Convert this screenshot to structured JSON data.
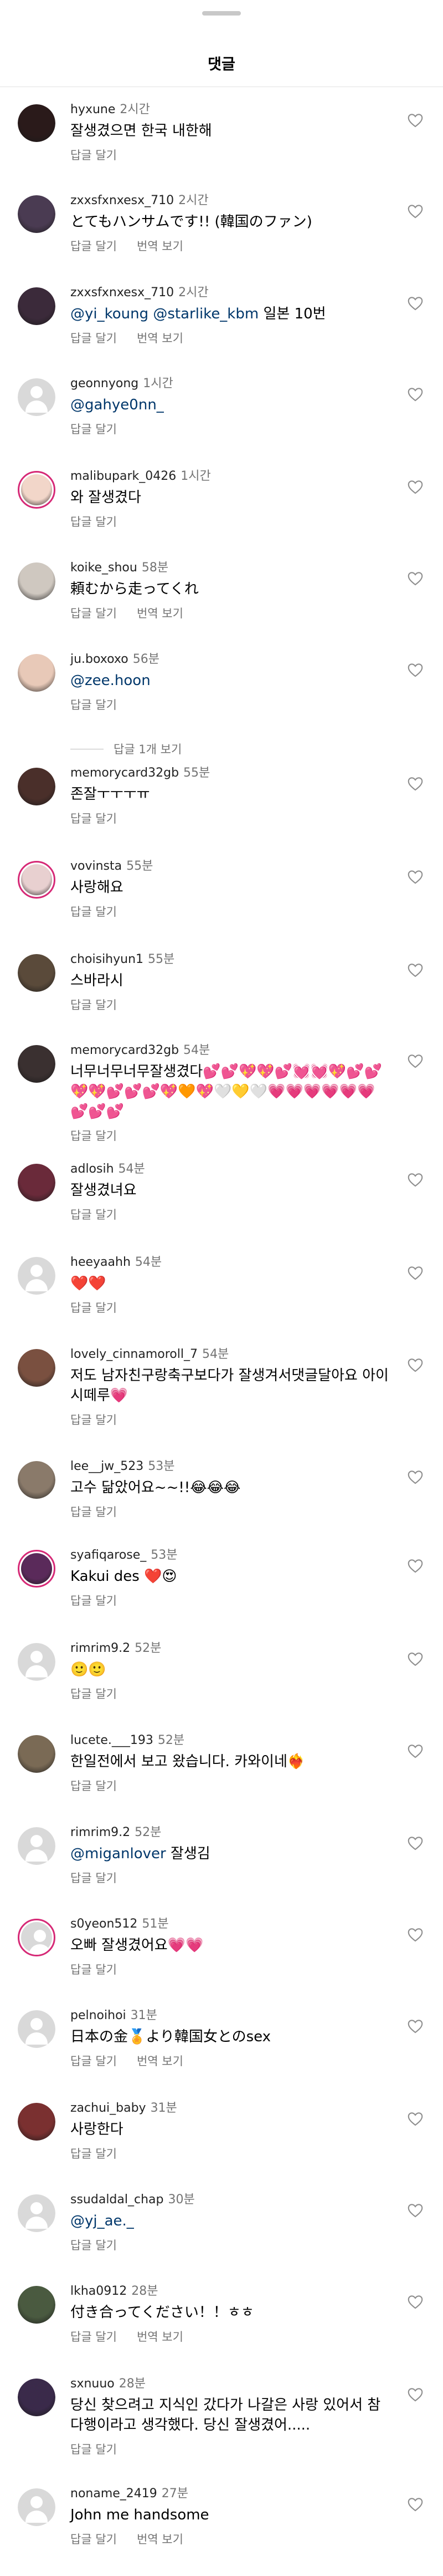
{
  "sheet": {
    "title": "댓글"
  },
  "actions": {
    "reply": "답글 달기",
    "translate": "번역 보기"
  },
  "comments": [
    {
      "user": "hyxune",
      "time": "2시간",
      "text": "잘생겼으면 한국 내한해",
      "translate": false
    },
    {
      "user": "zxxsfxnxesx_710",
      "time": "2시간",
      "text": "とてもハンサムです!! (韓国のファン)",
      "translate": true
    },
    {
      "user": "zxxsfxnxesx_710",
      "time": "2시간",
      "mentions": [
        "@yi_koung",
        "@starlike_kbm"
      ],
      "text": "일본 10번",
      "translate": true
    },
    {
      "user": "geonnyong",
      "time": "1시간",
      "mentions": [
        "@gahye0nn_"
      ],
      "text": "",
      "translate": false
    },
    {
      "user": "malibupark_0426",
      "time": "1시간",
      "text": "와 잘생겼다",
      "translate": false
    },
    {
      "user": "koike_shou",
      "time": "58분",
      "text": "頼むから走ってくれ",
      "translate": true
    },
    {
      "user": "ju.boxoxo",
      "time": "56분",
      "mentions": [
        "@zee.hoon"
      ],
      "text": "",
      "translate": false,
      "replies": "답글 1개 보기"
    },
    {
      "user": "memorycard32gb",
      "time": "55분",
      "text": "존잘ㅜㅜㅜㅠ",
      "translate": false
    },
    {
      "user": "vovinsta",
      "time": "55분",
      "text": "사랑해요",
      "translate": false
    },
    {
      "user": "choisihyun1",
      "time": "55분",
      "text": "스바라시",
      "translate": false
    },
    {
      "user": "memorycard32gb",
      "time": "54분",
      "text": "너무너무너무잘생겼다💕💕💖💖💕💓💓💖💕💕💖💖💕💕💕💖🧡💖🤍💛🤍💗💗💗💗💗💗💕💕💕",
      "translate": false
    },
    {
      "user": "adlosih",
      "time": "54분",
      "text": "잘생겼녀요",
      "translate": false
    },
    {
      "user": "heeyaahh",
      "time": "54분",
      "text": "❤️❤️",
      "translate": false
    },
    {
      "user": "lovely_cinnamoroll_7",
      "time": "54분",
      "text": "저도 남자친구랑축구보다가 잘생겨서댓글달아요 아이시떼루💗",
      "translate": false
    },
    {
      "user": "lee__jw_523",
      "time": "53분",
      "text": "고수 닮았어요~~!!😂😂😂",
      "translate": false
    },
    {
      "user": "syafiqarose_",
      "time": "53분",
      "text": "Kakui des ❤️😍",
      "translate": false
    },
    {
      "user": "rimrim9.2",
      "time": "52분",
      "text": "🙂🙂",
      "translate": false
    },
    {
      "user": "lucete.___193",
      "time": "52분",
      "text": "한일전에서 보고 왔습니다. 카와이네❤️‍🔥",
      "translate": false
    },
    {
      "user": "rimrim9.2",
      "time": "52분",
      "mentions": [
        "@miganlover"
      ],
      "text": "잘생김",
      "translate": false
    },
    {
      "user": "s0yeon512",
      "time": "51분",
      "text": "오빠 잘생겼어요💗💗",
      "translate": false
    },
    {
      "user": "pelnoihoi",
      "time": "31분",
      "text": "日本の金🏅より韓国女とのsex",
      "translate": true
    },
    {
      "user": "zachui_baby",
      "time": "31분",
      "text": "사랑한다",
      "translate": false
    },
    {
      "user": "ssudaldal_chap",
      "time": "30분",
      "mentions": [
        "@yj_ae._"
      ],
      "text": "",
      "translate": false
    },
    {
      "user": "lkha0912",
      "time": "28분",
      "text": "付き合ってください！！ㅎㅎ",
      "translate": true
    },
    {
      "user": "sxnuuo",
      "time": "28분",
      "text": "당신 찾으려고 지식인 갔다가 나갈은 사랑 있어서 참 다행이라고 생각했다. 당신 잘생겼어.....",
      "translate": false
    },
    {
      "user": "noname_2419",
      "time": "27분",
      "text": "John me handsome",
      "translate": true
    }
  ],
  "avatar_colors": [
    "#2a1a1a",
    "#4a3b52",
    "#3b2a3a",
    "#d9d9d9",
    "#f2d6c9",
    "#cfc8c0",
    "#e8c9b8",
    "#4a2f2a",
    "#e8d0d0",
    "#5a4a3a",
    "#3a3030",
    "#6a2a3a",
    "#d9d9d9",
    "#7a5040",
    "#8a7a6a",
    "#5a2a5a",
    "#d9d9d9",
    "#7a6a55",
    "#d9d9d9",
    "#d9d9d9",
    "#d9d9d9",
    "#7a3030",
    "#d9d9d9",
    "#4a5a40",
    "#3a2a4a",
    "#d9d9d9"
  ]
}
